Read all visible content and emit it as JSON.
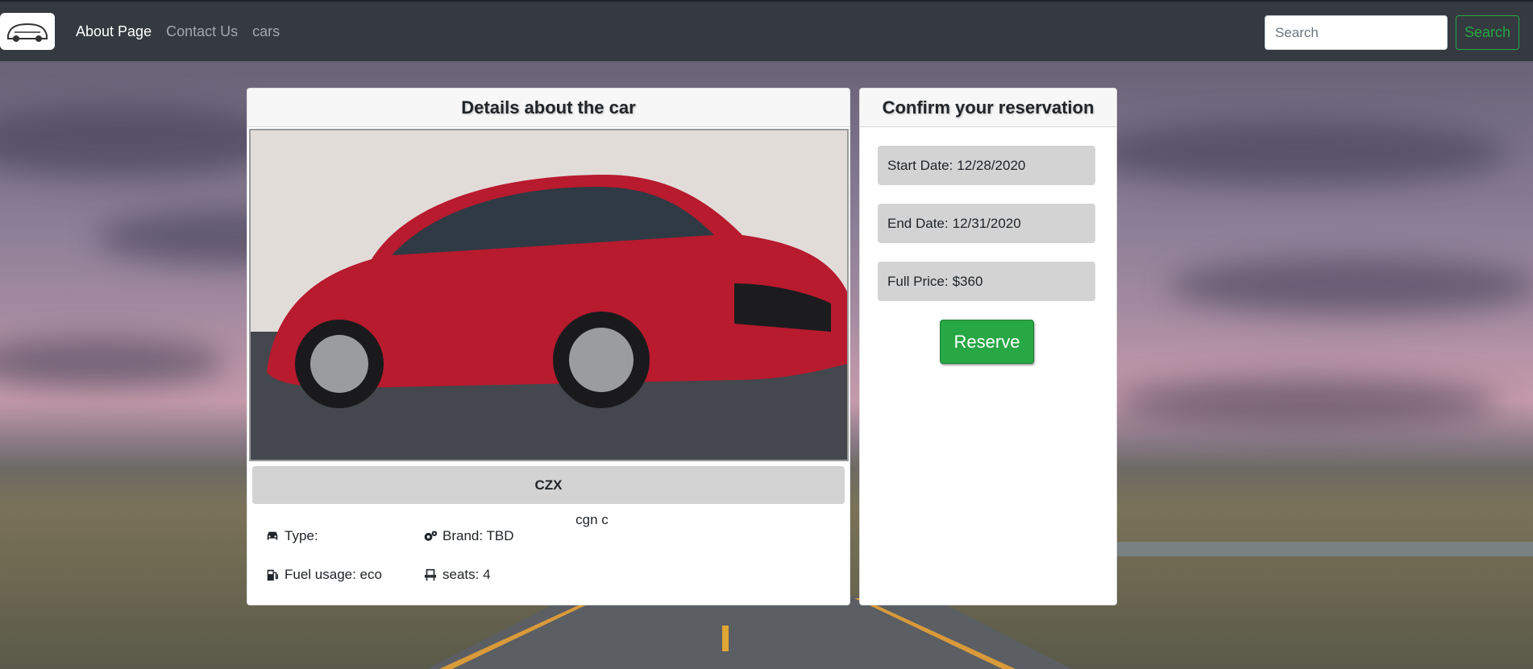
{
  "navbar": {
    "links": [
      "About Page",
      "Contact Us",
      "cars"
    ],
    "search_placeholder": "Search",
    "search_button": "Search"
  },
  "details": {
    "title": "Details about the car",
    "car_name": "CZX",
    "description": "cgn c",
    "specs": {
      "type": "Type:",
      "brand": "Brand: TBD",
      "fuel": "Fuel usage: eco",
      "seats": "seats: 4"
    }
  },
  "reservation": {
    "title": "Confirm your reservation",
    "start_label": "Start Date:",
    "start_value": "12/28/2020",
    "end_label": "End Date:",
    "end_value": "12/31/2020",
    "price_label": "Full Price:",
    "price_value": "$360",
    "reserve_button": "Reserve"
  },
  "colors": {
    "navbar": "#343a40",
    "accent_green": "#28a745",
    "field_gray": "#d3d3d3"
  },
  "icons": [
    "car-logo-icon",
    "car-icon",
    "cogs-icon",
    "gas-pump-icon",
    "seat-icon"
  ]
}
